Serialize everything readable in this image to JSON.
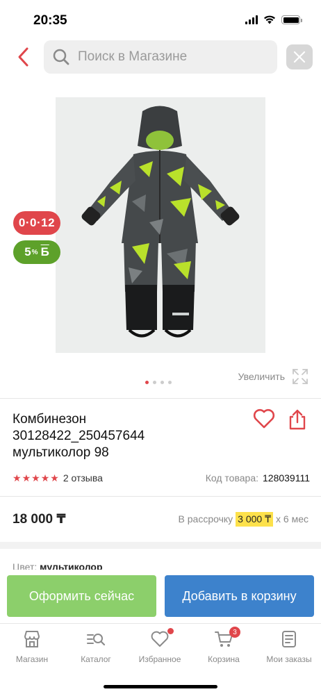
{
  "status_bar": {
    "time": "20:35"
  },
  "search": {
    "placeholder": "Поиск в Магазине"
  },
  "badges": {
    "installment": "0·0·12",
    "bonus_percent": "5",
    "bonus_sup": "%",
    "bonus_letter": "Б"
  },
  "gallery": {
    "zoom_label": "Увеличить",
    "dots": 4,
    "active_dot": 0
  },
  "product": {
    "title": "Комбинезон 30128422_250457644 мультиколор 98",
    "rating": 5,
    "reviews": "2 отзыва",
    "code_label": "Код товара:",
    "code_value": "128039111",
    "price": "18 000 ₸",
    "installment_prefix": "В рассрочку",
    "installment_amount": "3 000 ₸",
    "installment_suffix": "x 6 мес",
    "color_label": "Цвет:",
    "color_value": "мультиколор"
  },
  "actions": {
    "buy_now": "Оформить сейчас",
    "add_to_cart": "Добавить в корзину"
  },
  "tabbar": {
    "items": [
      {
        "label": "Магазин",
        "icon": "store-icon"
      },
      {
        "label": "Каталог",
        "icon": "catalog-search-icon"
      },
      {
        "label": "Избранное",
        "icon": "heart-icon"
      },
      {
        "label": "Корзина",
        "icon": "cart-icon",
        "badge": "3"
      },
      {
        "label": "Мои заказы",
        "icon": "orders-icon"
      }
    ]
  },
  "colors": {
    "accent": "#e0464b",
    "buy": "#8ccf6b",
    "cart": "#3d82cc",
    "bonus": "#5da12a",
    "highlight": "#fde14b"
  }
}
